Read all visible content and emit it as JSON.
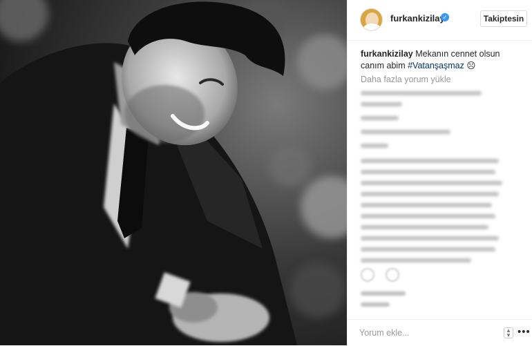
{
  "header": {
    "username": "furkankizilay",
    "verified_glyph": "✓",
    "follow_label": "Takiptesin"
  },
  "caption": {
    "user": "furkankizilay",
    "text": " Mekanın cennet olsun canım abim ",
    "hashtag": "#Vatanşaşmaz",
    "emoji": "☹"
  },
  "load_more_label": "Daha fazla yorum yükle",
  "comment_box": {
    "placeholder": "Yorum ekle...",
    "more_glyph": "•••"
  },
  "icons": {
    "like": "heart-icon",
    "comment": "comment-icon",
    "verified": "verified-badge-icon",
    "options": "more-options-icon"
  },
  "colors": {
    "hashtag": "#003569",
    "verified": "#3897f0",
    "muted": "#999999"
  }
}
